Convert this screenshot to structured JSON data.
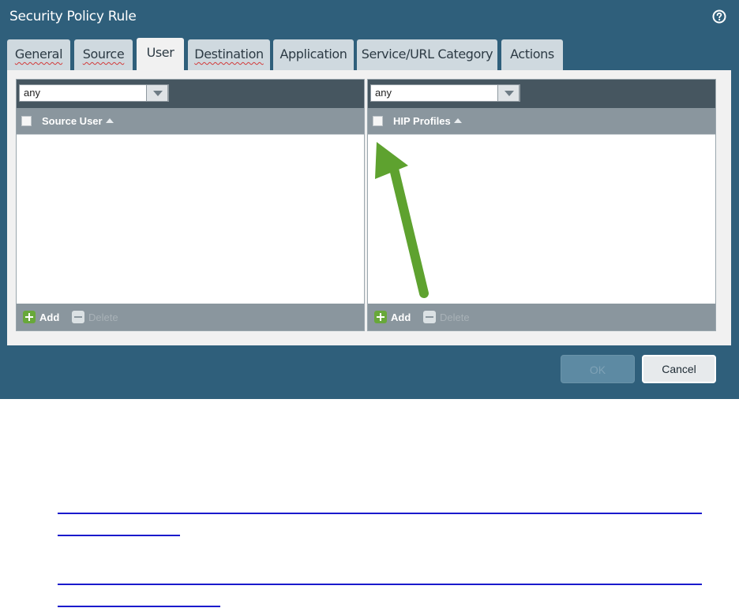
{
  "dialog": {
    "title": "Security Policy Rule",
    "help_icon": "question-circle-icon",
    "tabs": [
      {
        "label": "General"
      },
      {
        "label": "Source"
      },
      {
        "label": "User"
      },
      {
        "label": "Destination"
      },
      {
        "label": "Application"
      },
      {
        "label": "Service/URL Category"
      },
      {
        "label": "Actions"
      }
    ],
    "active_tab": "User",
    "left_panel": {
      "select_value": "any",
      "column_header": "Source User",
      "add_label": "Add",
      "delete_label": "Delete"
    },
    "right_panel": {
      "select_value": "any",
      "column_header": "HIP Profiles",
      "add_label": "Add",
      "delete_label": "Delete"
    },
    "buttons": {
      "ok": "OK",
      "cancel": "Cancel"
    }
  },
  "colors": {
    "dialog_bg": "#2f5f7b",
    "arrow": "#5ea22f",
    "link": "#1a1acc"
  }
}
